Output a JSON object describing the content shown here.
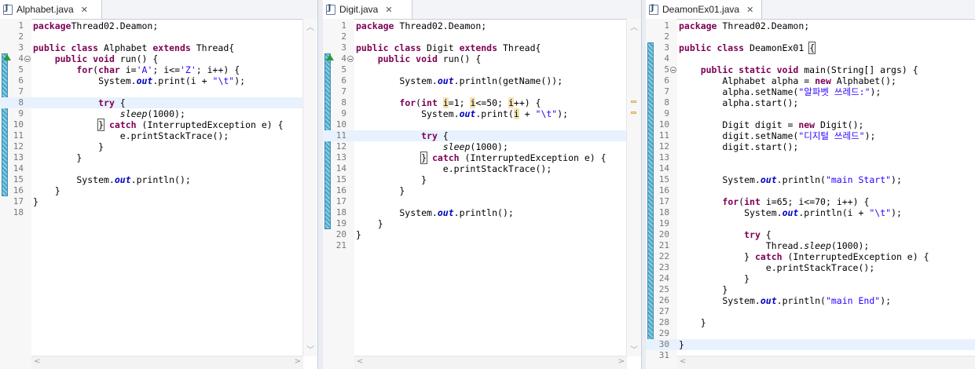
{
  "editors": [
    {
      "tab": "Alphabet.java",
      "lines": [
        {
          "n": "1",
          "c": [
            [
              "kw",
              "package"
            ],
            [
              "",
              "Thread02.Deamon;"
            ]
          ]
        },
        {
          "n": "2",
          "c": []
        },
        {
          "n": "3",
          "c": [
            [
              "kw",
              "public class"
            ],
            [
              "",
              " Alphabet "
            ],
            [
              "kw",
              "extends"
            ],
            [
              "",
              " Thread{"
            ]
          ]
        },
        {
          "n": "4",
          "c": [
            [
              "",
              "    "
            ],
            [
              "kw",
              "public void"
            ],
            [
              "",
              " run() {"
            ]
          ]
        },
        {
          "n": "5",
          "c": [
            [
              "",
              "        "
            ],
            [
              "kw",
              "for"
            ],
            [
              "",
              "("
            ],
            [
              "kw",
              "char"
            ],
            [
              "",
              " i="
            ],
            [
              "str",
              "'A'"
            ],
            [
              "",
              "; i<="
            ],
            [
              "str",
              "'Z'"
            ],
            [
              "",
              "; i++) {"
            ]
          ]
        },
        {
          "n": "6",
          "c": [
            [
              "",
              "            System."
            ],
            [
              "fld",
              "out"
            ],
            [
              "",
              ".print(i + "
            ],
            [
              "str",
              "\"\\t\""
            ],
            [
              "",
              ");"
            ]
          ]
        },
        {
          "n": "7",
          "c": []
        },
        {
          "n": "8",
          "c": [
            [
              "",
              "            "
            ],
            [
              "kw",
              "try"
            ],
            [
              "",
              " {"
            ]
          ]
        },
        {
          "n": "9",
          "c": [
            [
              "",
              "                "
            ],
            [
              "itl",
              "sleep"
            ],
            [
              "",
              "(1000);"
            ]
          ]
        },
        {
          "n": "10",
          "c": [
            [
              "",
              "            "
            ],
            [
              "box",
              "}"
            ],
            [
              "",
              " "
            ],
            [
              "kw",
              "catch"
            ],
            [
              "",
              " (InterruptedException e) {"
            ]
          ]
        },
        {
          "n": "11",
          "c": [
            [
              "",
              "                e.printStackTrace();"
            ]
          ]
        },
        {
          "n": "12",
          "c": [
            [
              "",
              "            }"
            ]
          ]
        },
        {
          "n": "13",
          "c": [
            [
              "",
              "        }"
            ]
          ]
        },
        {
          "n": "14",
          "c": []
        },
        {
          "n": "15",
          "c": [
            [
              "",
              "        System."
            ],
            [
              "fld",
              "out"
            ],
            [
              "",
              ".println();"
            ]
          ]
        },
        {
          "n": "16",
          "c": [
            [
              "",
              "    }"
            ]
          ]
        },
        {
          "n": "17",
          "c": [
            [
              "",
              "}"
            ]
          ]
        },
        {
          "n": "18",
          "c": []
        }
      ]
    },
    {
      "tab": "Digit.java",
      "lines": [
        {
          "n": "1",
          "c": [
            [
              "kw",
              "package"
            ],
            [
              "",
              " Thread02.Deamon;"
            ]
          ]
        },
        {
          "n": "2",
          "c": []
        },
        {
          "n": "3",
          "c": [
            [
              "kw",
              "public class"
            ],
            [
              "",
              " Digit "
            ],
            [
              "kw",
              "extends"
            ],
            [
              "",
              " Thread{"
            ]
          ]
        },
        {
          "n": "4",
          "c": [
            [
              "",
              "    "
            ],
            [
              "kw",
              "public void"
            ],
            [
              "",
              " run() {"
            ]
          ]
        },
        {
          "n": "5",
          "c": []
        },
        {
          "n": "6",
          "c": [
            [
              "",
              "        System."
            ],
            [
              "fld",
              "out"
            ],
            [
              "",
              ".println(getName());"
            ]
          ]
        },
        {
          "n": "7",
          "c": []
        },
        {
          "n": "8",
          "c": [
            [
              "",
              "        "
            ],
            [
              "kw",
              "for"
            ],
            [
              "",
              "("
            ],
            [
              "kw",
              "int"
            ],
            [
              "",
              " "
            ],
            [
              "occ",
              "i"
            ],
            [
              "",
              "=1; "
            ],
            [
              "occ",
              "i"
            ],
            [
              "",
              "<=50; "
            ],
            [
              "occ",
              "i"
            ],
            [
              "",
              "++) {"
            ]
          ]
        },
        {
          "n": "9",
          "c": [
            [
              "",
              "            System."
            ],
            [
              "fld",
              "out"
            ],
            [
              "",
              ".print("
            ],
            [
              "occ",
              "i"
            ],
            [
              "",
              " + "
            ],
            [
              "str",
              "\"\\t\""
            ],
            [
              "",
              ");"
            ]
          ]
        },
        {
          "n": "10",
          "c": []
        },
        {
          "n": "11",
          "c": [
            [
              "",
              "            "
            ],
            [
              "kw",
              "try"
            ],
            [
              "",
              " {"
            ]
          ]
        },
        {
          "n": "12",
          "c": [
            [
              "",
              "                "
            ],
            [
              "itl",
              "sleep"
            ],
            [
              "",
              "(1000);"
            ]
          ]
        },
        {
          "n": "13",
          "c": [
            [
              "",
              "            "
            ],
            [
              "box",
              "}"
            ],
            [
              "",
              " "
            ],
            [
              "kw",
              "catch"
            ],
            [
              "",
              " (InterruptedException e) {"
            ]
          ]
        },
        {
          "n": "14",
          "c": [
            [
              "",
              "                e.printStackTrace();"
            ]
          ]
        },
        {
          "n": "15",
          "c": [
            [
              "",
              "            }"
            ]
          ]
        },
        {
          "n": "16",
          "c": [
            [
              "",
              "        }"
            ]
          ]
        },
        {
          "n": "17",
          "c": []
        },
        {
          "n": "18",
          "c": [
            [
              "",
              "        System."
            ],
            [
              "fld",
              "out"
            ],
            [
              "",
              ".println();"
            ]
          ]
        },
        {
          "n": "19",
          "c": [
            [
              "",
              "    }"
            ]
          ]
        },
        {
          "n": "20",
          "c": [
            [
              "",
              "}"
            ]
          ]
        },
        {
          "n": "21",
          "c": []
        }
      ]
    },
    {
      "tab": "DeamonEx01.java",
      "lines": [
        {
          "n": "1",
          "c": [
            [
              "kw",
              "package"
            ],
            [
              "",
              " Thread02.Deamon;"
            ]
          ]
        },
        {
          "n": "2",
          "c": []
        },
        {
          "n": "3",
          "c": [
            [
              "kw",
              "public class"
            ],
            [
              "",
              " DeamonEx01 "
            ],
            [
              "box",
              "{"
            ]
          ]
        },
        {
          "n": "4",
          "c": []
        },
        {
          "n": "5",
          "c": [
            [
              "",
              "    "
            ],
            [
              "kw",
              "public static void"
            ],
            [
              "",
              " main(String[] args) {"
            ]
          ]
        },
        {
          "n": "6",
          "c": [
            [
              "",
              "        Alphabet alpha = "
            ],
            [
              "kw",
              "new"
            ],
            [
              "",
              " Alphabet();"
            ]
          ]
        },
        {
          "n": "7",
          "c": [
            [
              "",
              "        alpha.setName("
            ],
            [
              "str",
              "\"알파벳 쓰레드:\""
            ],
            [
              "",
              ");"
            ]
          ]
        },
        {
          "n": "8",
          "c": [
            [
              "",
              "        alpha.start();"
            ]
          ]
        },
        {
          "n": "9",
          "c": []
        },
        {
          "n": "10",
          "c": [
            [
              "",
              "        Digit digit = "
            ],
            [
              "kw",
              "new"
            ],
            [
              "",
              " Digit();"
            ]
          ]
        },
        {
          "n": "11",
          "c": [
            [
              "",
              "        digit.setName("
            ],
            [
              "str",
              "\"디지털 쓰레드\""
            ],
            [
              "",
              ");"
            ]
          ]
        },
        {
          "n": "12",
          "c": [
            [
              "",
              "        digit.start();"
            ]
          ]
        },
        {
          "n": "13",
          "c": []
        },
        {
          "n": "14",
          "c": []
        },
        {
          "n": "15",
          "c": [
            [
              "",
              "        System."
            ],
            [
              "fld",
              "out"
            ],
            [
              "",
              ".println("
            ],
            [
              "str",
              "\"main Start\""
            ],
            [
              "",
              ");"
            ]
          ]
        },
        {
          "n": "16",
          "c": []
        },
        {
          "n": "17",
          "c": [
            [
              "",
              "        "
            ],
            [
              "kw",
              "for"
            ],
            [
              "",
              "("
            ],
            [
              "kw",
              "int"
            ],
            [
              "",
              " i=65; i<=70; i++) {"
            ]
          ]
        },
        {
          "n": "18",
          "c": [
            [
              "",
              "            System."
            ],
            [
              "fld",
              "out"
            ],
            [
              "",
              ".println(i + "
            ],
            [
              "str",
              "\"\\t\""
            ],
            [
              "",
              ");"
            ]
          ]
        },
        {
          "n": "19",
          "c": []
        },
        {
          "n": "20",
          "c": [
            [
              "",
              "            "
            ],
            [
              "kw",
              "try"
            ],
            [
              "",
              " {"
            ]
          ]
        },
        {
          "n": "21",
          "c": [
            [
              "",
              "                Thread."
            ],
            [
              "itl",
              "sleep"
            ],
            [
              "",
              "(1000);"
            ]
          ]
        },
        {
          "n": "22",
          "c": [
            [
              "",
              "            } "
            ],
            [
              "kw",
              "catch"
            ],
            [
              "",
              " (InterruptedException e) {"
            ]
          ]
        },
        {
          "n": "23",
          "c": [
            [
              "",
              "                e.printStackTrace();"
            ]
          ]
        },
        {
          "n": "24",
          "c": [
            [
              "",
              "            }"
            ]
          ]
        },
        {
          "n": "25",
          "c": [
            [
              "",
              "        }"
            ]
          ]
        },
        {
          "n": "26",
          "c": [
            [
              "",
              "        System."
            ],
            [
              "fld",
              "out"
            ],
            [
              "",
              ".println("
            ],
            [
              "str",
              "\"main End\""
            ],
            [
              "",
              ");"
            ]
          ]
        },
        {
          "n": "27",
          "c": []
        },
        {
          "n": "28",
          "c": [
            [
              "",
              "    }"
            ]
          ]
        },
        {
          "n": "29",
          "c": []
        },
        {
          "n": "30",
          "c": [
            [
              "",
              "}"
            ]
          ]
        },
        {
          "n": "31",
          "c": []
        }
      ]
    }
  ],
  "icons": {
    "file": "java-file-icon",
    "close": "close-icon",
    "fold": "fold-minus-icon",
    "override": "override-triangle-icon",
    "scroll_up": "scroll-up-icon",
    "scroll_down": "scroll-down-icon",
    "scroll_left": "scroll-left-icon",
    "scroll_right": "scroll-right-icon"
  },
  "colors": {
    "keyword": "#7f0055",
    "string": "#2a00ff",
    "field": "#0000c0",
    "current_line": "#e8f2fe",
    "change_bar": "#4aa3c7"
  }
}
